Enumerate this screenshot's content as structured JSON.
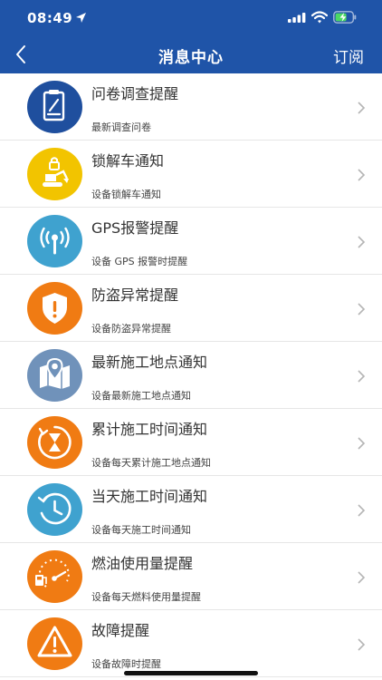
{
  "status_bar": {
    "time": "08:49"
  },
  "nav": {
    "title": "消息中心",
    "subscribe_label": "订阅"
  },
  "colors": {
    "header_bg": "#1f54a8",
    "navy": "#1f4f9e",
    "yellow": "#f2c400",
    "teal": "#3fa2cf",
    "orange": "#f07b13",
    "slate": "#7092ba"
  },
  "items": [
    {
      "title": "问卷调查提醒",
      "subtitle": "最新调查问卷",
      "icon": "survey-icon"
    },
    {
      "title": "锁解车通知",
      "subtitle": "设备锁解车通知",
      "icon": "excavator-lock-icon"
    },
    {
      "title": "GPS报警提醒",
      "subtitle": "设备 GPS 报警时提醒",
      "icon": "gps-signal-icon"
    },
    {
      "title": "防盗异常提醒",
      "subtitle": "设备防盗异常提醒",
      "icon": "shield-alert-icon"
    },
    {
      "title": "最新施工地点通知",
      "subtitle": "设备最新施工地点通知",
      "icon": "map-pin-icon"
    },
    {
      "title": "累计施工时间通知",
      "subtitle": "设备每天累计施工地点通知",
      "icon": "hourglass-icon"
    },
    {
      "title": "当天施工时间通知",
      "subtitle": "设备每天施工时间通知",
      "icon": "clock-icon"
    },
    {
      "title": "燃油使用量提醒",
      "subtitle": "设备每天燃料使用量提醒",
      "icon": "fuel-gauge-icon"
    },
    {
      "title": "故障提醒",
      "subtitle": "设备故障时提醒",
      "icon": "warning-icon"
    }
  ]
}
